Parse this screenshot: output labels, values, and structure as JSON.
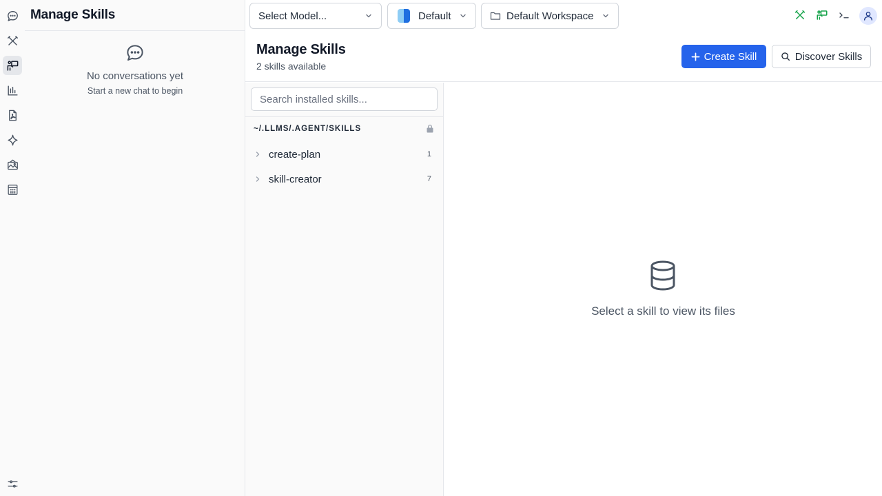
{
  "sidebar": {
    "title": "Manage Skills",
    "empty_title": "No conversations yet",
    "empty_subtitle": "Start a new chat to begin"
  },
  "rail": {
    "items": [
      {
        "icon": "chat-bubble-icon",
        "active": false
      },
      {
        "icon": "tools-icon",
        "active": false
      },
      {
        "icon": "presentation-icon",
        "active": true
      },
      {
        "icon": "bar-chart-icon",
        "active": false
      },
      {
        "icon": "pdf-file-icon",
        "active": false
      },
      {
        "icon": "sparkle-icon",
        "active": false
      },
      {
        "icon": "image-gallery-icon",
        "active": false
      },
      {
        "icon": "calculator-icon",
        "active": false
      }
    ],
    "bottom_icon": "sliders-icon"
  },
  "topbar": {
    "model_select": "Select Model...",
    "profile_select": "Default",
    "workspace_select": "Default Workspace",
    "icons": [
      "tools-icon",
      "presentation-icon",
      "terminal-icon",
      "user-icon"
    ]
  },
  "page": {
    "title": "Manage Skills",
    "subtitle": "2 skills available",
    "create_label": "Create Skill",
    "discover_label": "Discover Skills"
  },
  "skills": {
    "search_placeholder": "Search installed skills...",
    "path": "~/.LLMS/.AGENT/SKILLS",
    "items": [
      {
        "name": "create-plan",
        "count": "1"
      },
      {
        "name": "skill-creator",
        "count": "7"
      }
    ]
  },
  "detail": {
    "empty_text": "Select a skill to view its files"
  },
  "colors": {
    "accent": "#2563eb",
    "green_icon": "#16a34a",
    "border": "#e5e7eb"
  }
}
